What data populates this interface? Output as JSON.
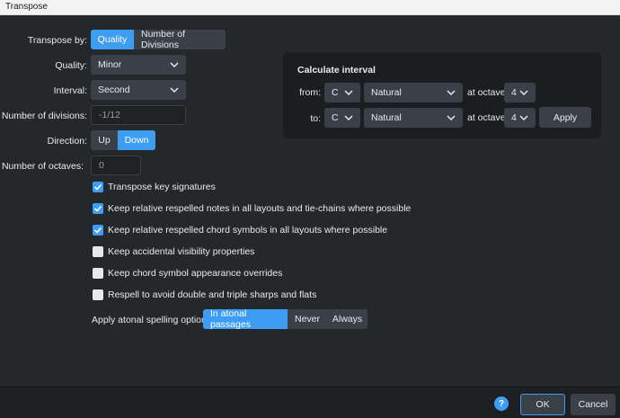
{
  "window": {
    "title": "Transpose"
  },
  "transpose_by": {
    "label": "Transpose by:",
    "options": [
      "Quality",
      "Number of Divisions"
    ],
    "selected": "Quality"
  },
  "quality": {
    "label": "Quality:",
    "value": "Minor"
  },
  "interval": {
    "label": "Interval:",
    "value": "Second"
  },
  "divisions": {
    "label": "Number of divisions:",
    "value": "-1/12"
  },
  "direction": {
    "label": "Direction:",
    "options": [
      "Up",
      "Down"
    ],
    "selected": "Down"
  },
  "octaves": {
    "label": "Number of octaves:",
    "value": "0"
  },
  "checkboxes": [
    {
      "label": "Transpose key signatures",
      "checked": true
    },
    {
      "label": "Keep relative respelled notes in all layouts and tie-chains where possible",
      "checked": true
    },
    {
      "label": "Keep relative respelled chord symbols in all layouts where possible",
      "checked": true
    },
    {
      "label": "Keep accidental visibility properties",
      "checked": false
    },
    {
      "label": "Keep chord symbol appearance overrides",
      "checked": false
    },
    {
      "label": "Respell to avoid double and triple sharps and flats",
      "checked": false
    }
  ],
  "atonal": {
    "label": "Apply atonal spelling options:",
    "options": [
      "In atonal passages",
      "Never",
      "Always"
    ],
    "selected": "In atonal passages"
  },
  "calc": {
    "title": "Calculate interval",
    "from_label": "from:",
    "to_label": "to:",
    "octave_label": "at octave",
    "from": {
      "note": "C",
      "accidental": "Natural",
      "octave": "4"
    },
    "to": {
      "note": "C",
      "accidental": "Natural",
      "octave": "4"
    },
    "apply_label": "Apply"
  },
  "footer": {
    "help": "?",
    "ok": "OK",
    "cancel": "Cancel"
  },
  "colors": {
    "accent": "#3d9df3",
    "background": "#25282b",
    "control": "#3a4047"
  }
}
